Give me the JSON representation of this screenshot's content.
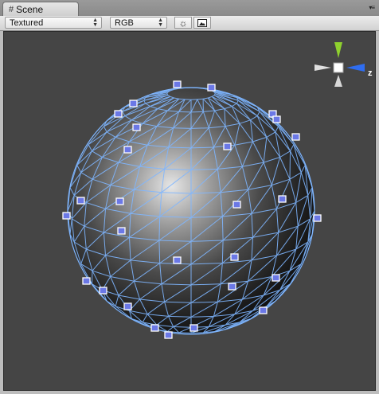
{
  "window": {
    "tab_label": "Scene",
    "tab_icon": "grid-icon",
    "tab_menu_icon": "panel-menu-icon"
  },
  "toolbar": {
    "render_mode": "Textured",
    "color_channel": "RGB",
    "lighting_icon": "sun-icon",
    "image_icon": "image-icon"
  },
  "gizmo": {
    "axis_label_z": "z",
    "colors": {
      "y": "#8fd12e",
      "z": "#2f6df0",
      "x": "#e0e0e0",
      "center": "#ffffff"
    }
  },
  "scene": {
    "sphere_wire_color": "#7fb6ff",
    "vertex_handle_color": "#5f6dd8"
  }
}
